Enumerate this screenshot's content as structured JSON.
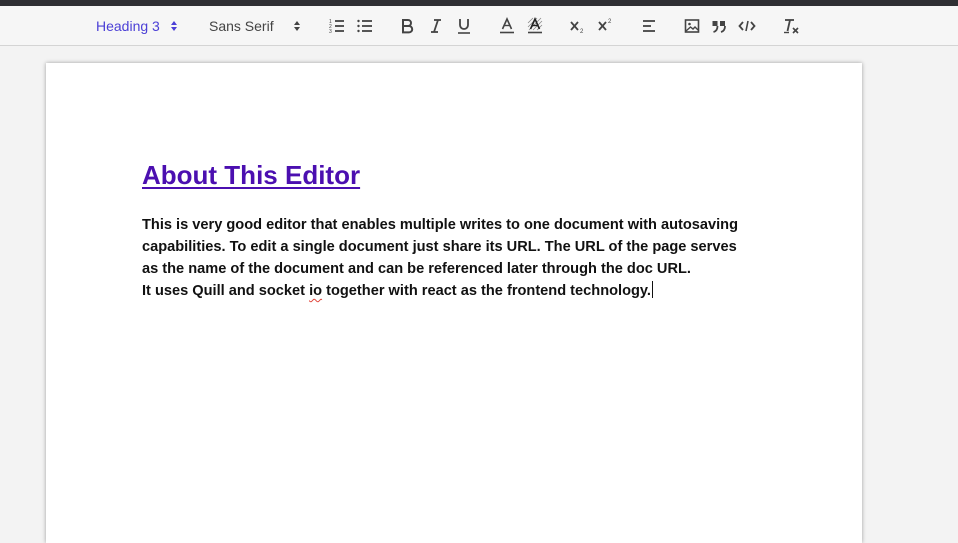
{
  "toolbar": {
    "heading_picker": {
      "label": "Heading 3",
      "color": "#4b3fd6"
    },
    "font_picker": {
      "label": "Sans Serif"
    },
    "buttons": {
      "ordered_list": "ordered-list-icon",
      "bullet_list": "bullet-list-icon",
      "bold": "bold-icon",
      "italic": "italic-icon",
      "underline": "underline-icon",
      "text_color": "text-color-icon",
      "background_color": "background-color-icon",
      "subscript": "subscript-icon",
      "superscript": "superscript-icon",
      "align": "align-left-icon",
      "image": "image-icon",
      "blockquote": "blockquote-icon",
      "code_block": "code-block-icon",
      "clean": "clear-formatting-icon"
    }
  },
  "document": {
    "heading": "About This Editor",
    "heading_color": "#4b0fb0",
    "lines": [
      "This is very good editor that enables multiple writes to one document with autosaving",
      "capabilities. To edit a single document just share its URL. The URL of the page serves",
      "as the name of the document and can be  referenced later through the doc URL."
    ],
    "last_line": {
      "before": "It uses Quill and socket ",
      "misspelled": "io",
      "after": " together with react as the frontend technology."
    }
  }
}
